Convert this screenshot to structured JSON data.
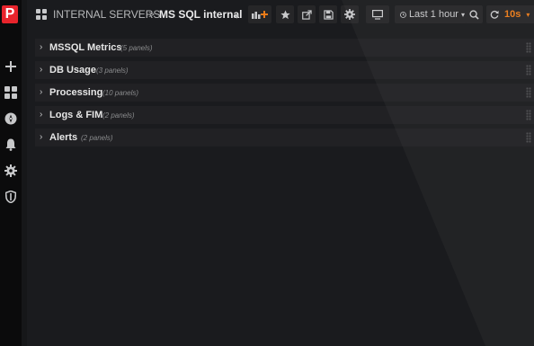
{
  "sidebar": {
    "logo_letter": "P",
    "items": [
      {
        "name": "create-icon",
        "glyph": "+"
      },
      {
        "name": "dashboards-icon",
        "glyph": "grid"
      },
      {
        "name": "explore-icon",
        "glyph": "compass"
      },
      {
        "name": "alerting-icon",
        "glyph": "bell"
      },
      {
        "name": "configuration-icon",
        "glyph": "gear"
      },
      {
        "name": "shield-icon",
        "glyph": "shield"
      }
    ]
  },
  "header": {
    "folder": "INTERNAL SERVERS",
    "separator": ">",
    "dashboard_title": "MS SQL internal",
    "title_caret": "▾",
    "time_range": "Last 1 hour",
    "refresh_interval": "10s",
    "caret": "▾"
  },
  "rows": [
    {
      "title": "MSSQL Metrics",
      "count": "(5 panels)"
    },
    {
      "title": "DB Usage",
      "count": "(3 panels)"
    },
    {
      "title": "Processing",
      "count": "(10 panels)"
    },
    {
      "title": "Logs & FIM",
      "count": "(2 panels)"
    },
    {
      "title": "Alerts",
      "count": "(2 panels)"
    }
  ],
  "colors": {
    "background": "#161719",
    "sidebar": "#0b0b0c",
    "logo": "#e8242c",
    "refresh_accent": "#eb7b18",
    "row": "#212124"
  }
}
